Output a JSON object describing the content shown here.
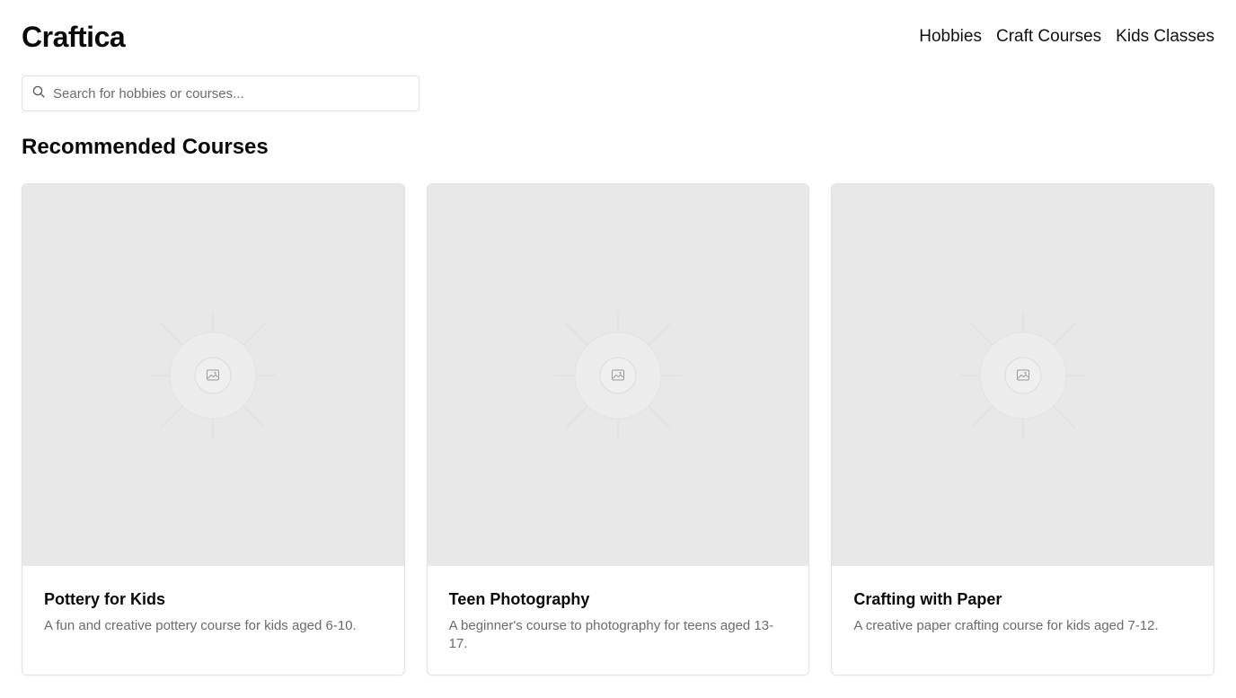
{
  "brand": {
    "name": "Craftica"
  },
  "nav": {
    "items": [
      {
        "label": "Hobbies"
      },
      {
        "label": "Craft Courses"
      },
      {
        "label": "Kids Classes"
      }
    ]
  },
  "search": {
    "placeholder": "Search for hobbies or courses...",
    "value": "",
    "icon": "search-icon"
  },
  "section": {
    "title": "Recommended Courses"
  },
  "courses": [
    {
      "title": "Pottery for Kids",
      "description": "A fun and creative pottery course for kids aged 6-10.",
      "image_icon": "image-placeholder-icon"
    },
    {
      "title": "Teen Photography",
      "description": "A beginner's course to photography for teens aged 13-17.",
      "image_icon": "image-placeholder-icon"
    },
    {
      "title": "Crafting with Paper",
      "description": "A creative paper crafting course for kids aged 7-12.",
      "image_icon": "image-placeholder-icon"
    }
  ],
  "colors": {
    "placeholder_bg": "#e8e8e8",
    "muted_text": "#6b6b6b",
    "border": "#e3e3e3"
  }
}
